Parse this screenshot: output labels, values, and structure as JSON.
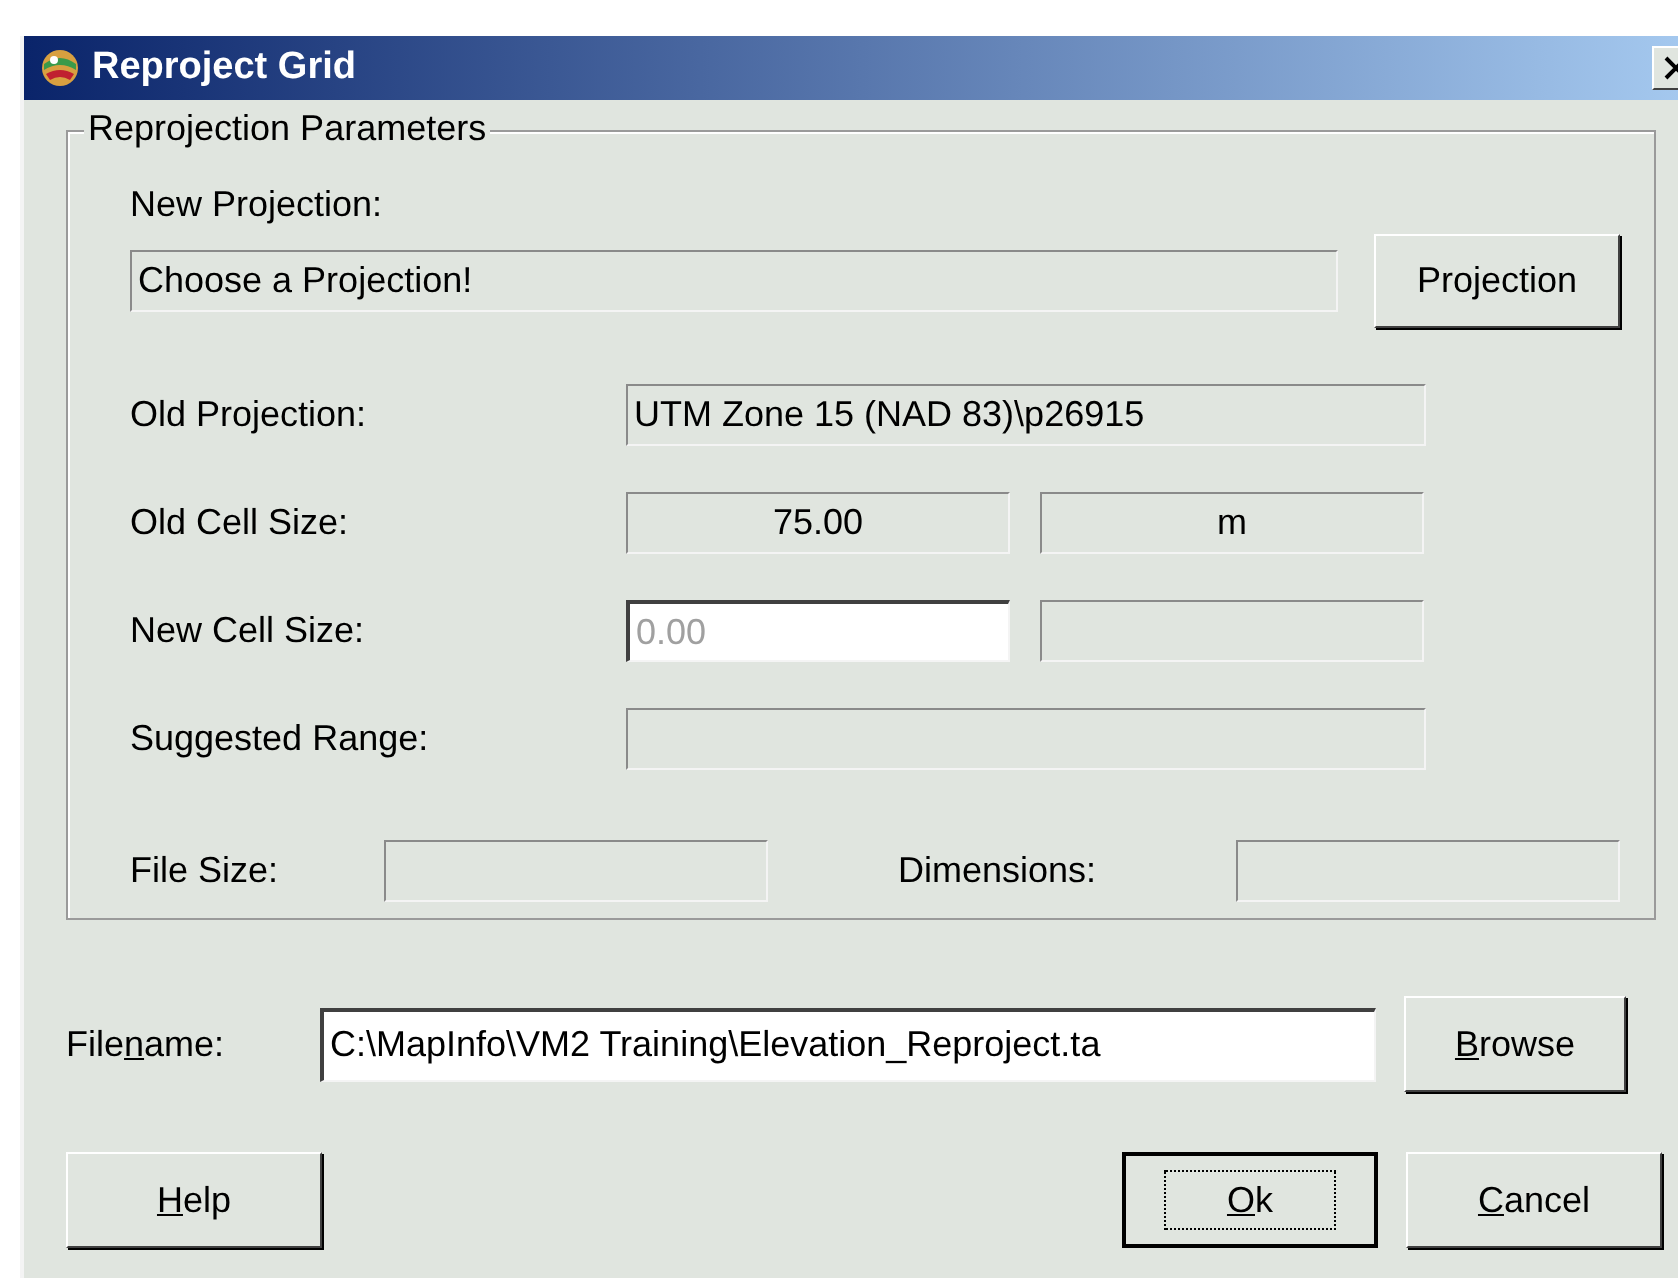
{
  "window": {
    "title": "Reproject Grid"
  },
  "parameters": {
    "title": "Reprojection Parameters",
    "new_projection": {
      "label": "New Projection:",
      "value": "Choose a Projection!"
    },
    "projection_button": {
      "label": "Projection"
    },
    "old_projection": {
      "label": "Old Projection:",
      "value": "UTM Zone 15 (NAD 83)\\p26915"
    },
    "old_cell_size": {
      "label": "Old Cell Size:",
      "value": "75.00",
      "unit": "m"
    },
    "new_cell_size": {
      "label": "New Cell Size:",
      "placeholder": "0.00"
    },
    "suggested_range": {
      "label": "Suggested Range:"
    },
    "file_size": {
      "label": "File Size:"
    },
    "dimensions": {
      "label": "Dimensions:"
    }
  },
  "filename": {
    "label": "Filename:",
    "value": "C:\\MapInfo\\VM2 Training\\Elevation_Reproject.ta"
  },
  "browse_button": {
    "label": "Browse"
  },
  "buttons": [
    {
      "label": "Help",
      "default": false
    },
    {
      "label": "Ok",
      "default": true
    },
    {
      "label": "Cancel",
      "default": false
    }
  ]
}
